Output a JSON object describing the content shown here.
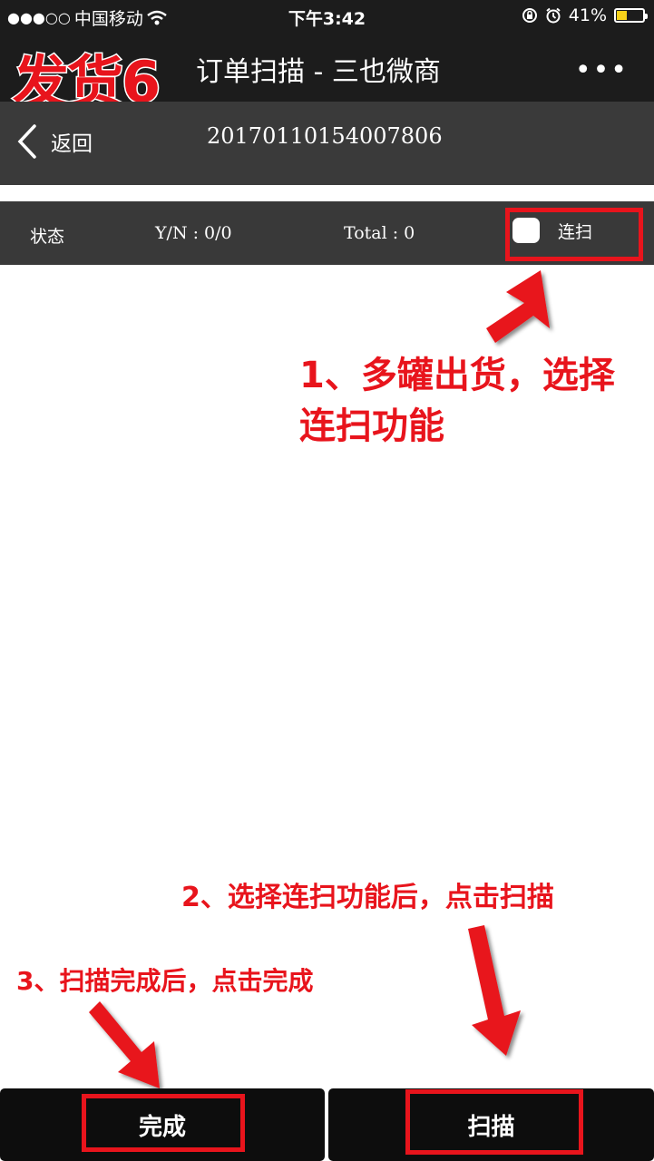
{
  "status_bar": {
    "signal": "●●●○○",
    "carrier": "中国移动",
    "time": "下午3:42",
    "battery": "41%",
    "battery_level": 0.41,
    "battery_color": "#f7d21a"
  },
  "title_bar": {
    "overlay_label": "发货6",
    "title": "订单扫描 - 三也微商",
    "more": "•••"
  },
  "nav": {
    "back_label": "返回",
    "order_number": "20170110154007806"
  },
  "status_row": {
    "status_label": "状态",
    "yn": "Y/N : 0/0",
    "total": "Total : 0",
    "continuous_label": "连扫"
  },
  "annotations": {
    "step1": "1、多罐出货，选择连扫功能",
    "step2": "2、选择连扫功能后，点击扫描",
    "step3": "3、扫描完成后，点击完成"
  },
  "buttons": {
    "done": "完成",
    "scan": "扫描"
  },
  "colors": {
    "annotation_red": "#e8141c",
    "bar_dark": "#1c1c1c",
    "nav_gray": "#3a3a3a"
  }
}
